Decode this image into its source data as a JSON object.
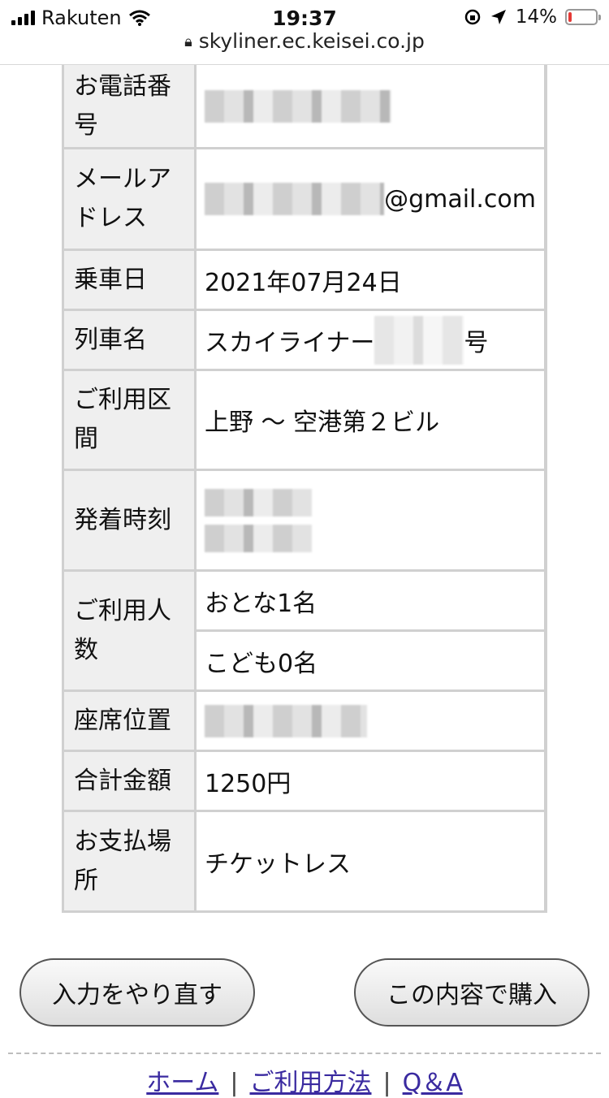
{
  "status_bar": {
    "carrier": "Rakuten",
    "time": "19:37",
    "battery_percent": "14%",
    "battery_level": 0.14,
    "icons": [
      "signal-bars-icon",
      "wifi-icon",
      "orientation-lock-icon",
      "location-arrow-icon",
      "battery-icon"
    ]
  },
  "browser": {
    "url": "skyliner.ec.keisei.co.jp"
  },
  "details": {
    "phone_label": "お電話番号",
    "email_label": "メールアドレス",
    "email_suffix": "@gmail.com",
    "date_label": "乗車日",
    "date_value": "2021年07月24日",
    "train_label": "列車名",
    "train_prefix": "スカイライナー",
    "train_suffix": "号",
    "section_label": "ご利用区間",
    "section_value": "上野 〜 空港第２ビル",
    "time_label": "発着時刻",
    "passengers_label": "ご利用人数",
    "adults_value": "おとな1名",
    "children_value": "こども0名",
    "seat_label": "座席位置",
    "total_label": "合計金額",
    "total_value": "1250円",
    "payment_label": "お支払場所",
    "payment_value": "チケットレス"
  },
  "buttons": {
    "redo": "入力をやり直す",
    "purchase": "この内容で購入"
  },
  "footer": {
    "links": [
      "ホーム",
      "ご利用方法",
      "Q＆A"
    ],
    "separator": "|"
  },
  "colors": {
    "link": "#3a2aa0",
    "label_bg": "#efefef",
    "border": "#d0d0d0",
    "battery_low": "#e53935"
  }
}
